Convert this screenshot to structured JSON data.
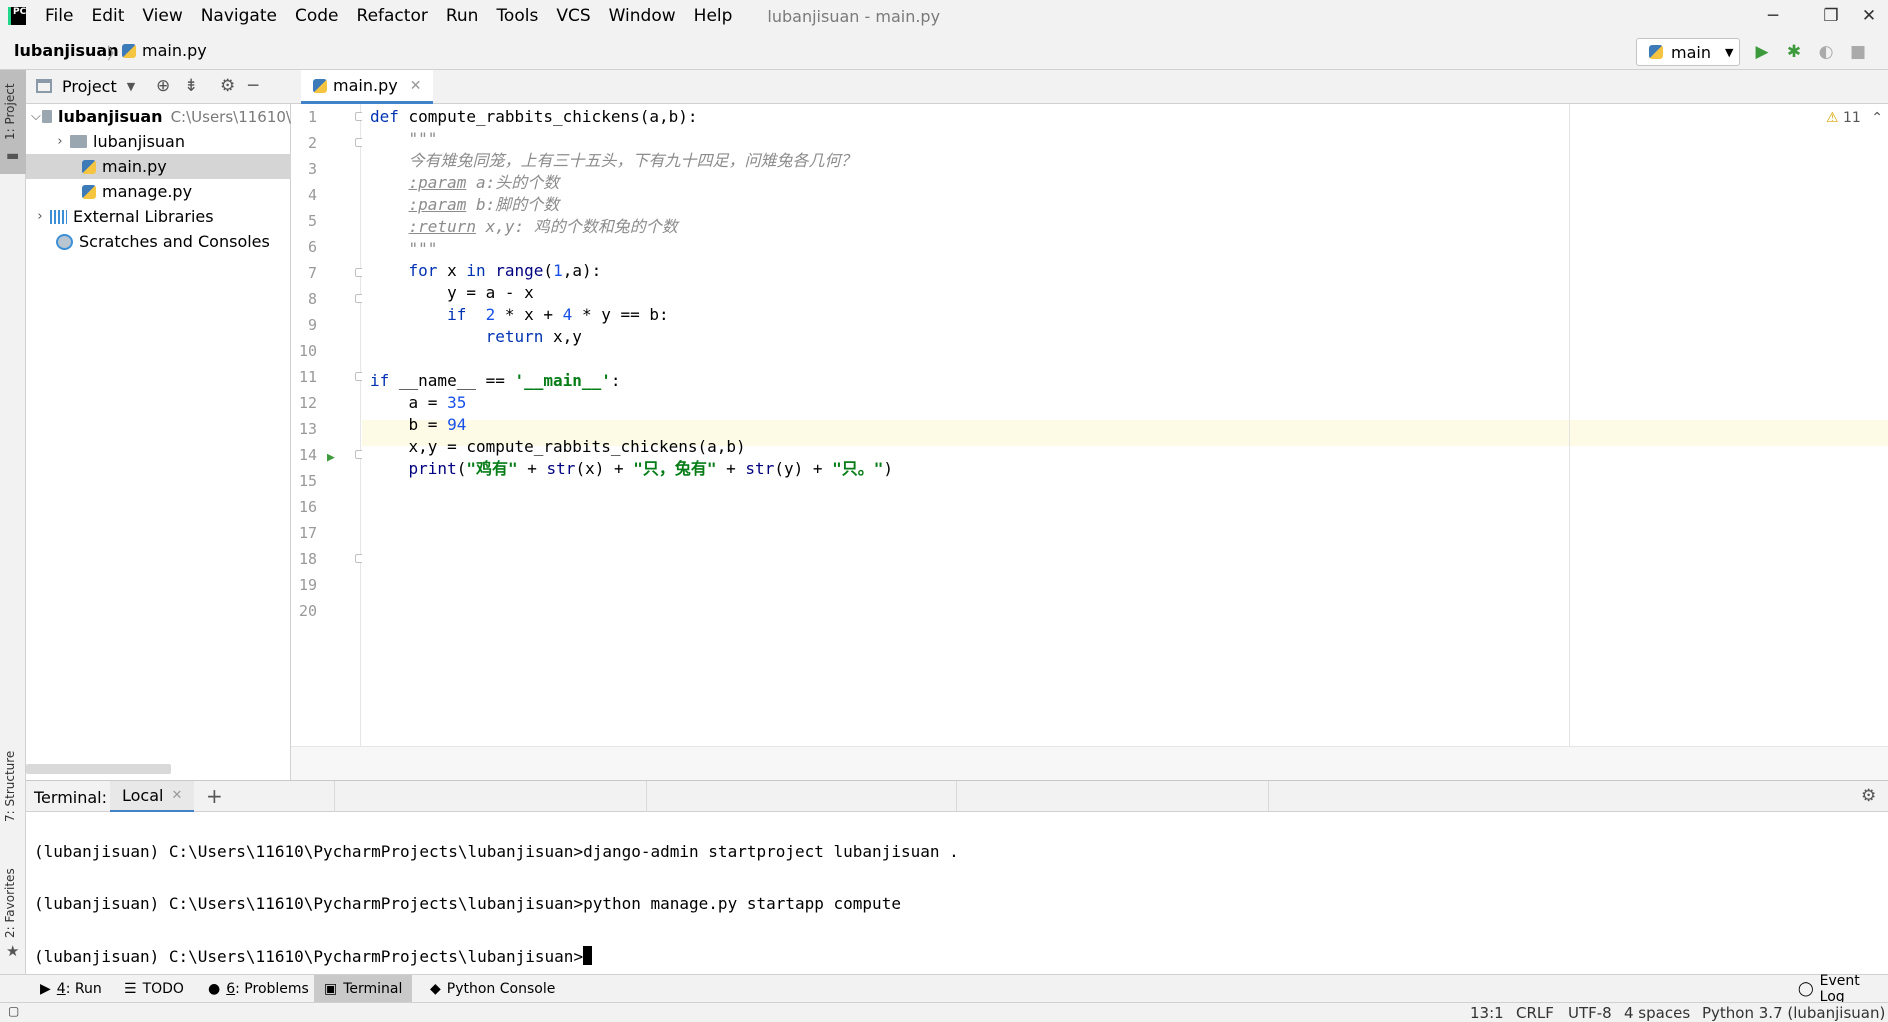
{
  "menubar": {
    "app_logo_text": "PC",
    "items": [
      "File",
      "Edit",
      "View",
      "Navigate",
      "Code",
      "Refactor",
      "Run",
      "Tools",
      "VCS",
      "Window",
      "Help"
    ],
    "window_title": "lubanjisuan - main.py"
  },
  "window_controls": {
    "minimize": "─",
    "restore": "❐",
    "close": "✕"
  },
  "navbar": {
    "project": "lubanjisuan",
    "separator": "〉",
    "file": "main.py",
    "run_config": "main",
    "icons": [
      "run-icon",
      "debug-icon",
      "coverage-icon",
      "stop-icon"
    ]
  },
  "left_strip": {
    "project_tab": "1: Project",
    "structure_tab": "7: Structure",
    "favorites_tab": "2: Favorites"
  },
  "project_panel": {
    "title": "Project",
    "tree": [
      {
        "label": "lubanjisuan",
        "hint": "C:\\Users\\11610\\",
        "type": "root"
      },
      {
        "label": "lubanjisuan",
        "type": "folder"
      },
      {
        "label": "main.py",
        "type": "file",
        "selected": true
      },
      {
        "label": "manage.py",
        "type": "file"
      },
      {
        "label": "External Libraries",
        "type": "library"
      },
      {
        "label": "Scratches and Consoles",
        "type": "scratch"
      }
    ]
  },
  "editor": {
    "tab": "main.py",
    "warning_count": "11",
    "current_line": 13,
    "line_numbers": [
      "1",
      "2",
      "3",
      "4",
      "5",
      "6",
      "7",
      "8",
      "9",
      "10",
      "11",
      "12",
      "13",
      "14",
      "15",
      "16",
      "17",
      "18",
      "19",
      "20"
    ]
  },
  "terminal": {
    "label": "Terminal:",
    "tab": "Local",
    "add": "+",
    "lines": [
      "(lubanjisuan) C:\\Users\\11610\\PycharmProjects\\lubanjisuan>django-admin startproject lubanjisuan .",
      "(lubanjisuan) C:\\Users\\11610\\PycharmProjects\\lubanjisuan>python manage.py startapp compute",
      "(lubanjisuan) C:\\Users\\11610\\PycharmProjects\\lubanjisuan>"
    ]
  },
  "tool_tabs": {
    "run_key": "4",
    "run_label": ": Run",
    "todo": "TODO",
    "problems_key": "6",
    "problems_label": ": Problems",
    "terminal": "Terminal",
    "python_console": "Python Console",
    "event_log": "Event Log"
  },
  "status_bar": {
    "position": "13:1",
    "line_sep": "CRLF",
    "encoding": "UTF-8",
    "indent": "4 spaces",
    "interpreter": "Python 3.7 (lubanjisuan)"
  }
}
